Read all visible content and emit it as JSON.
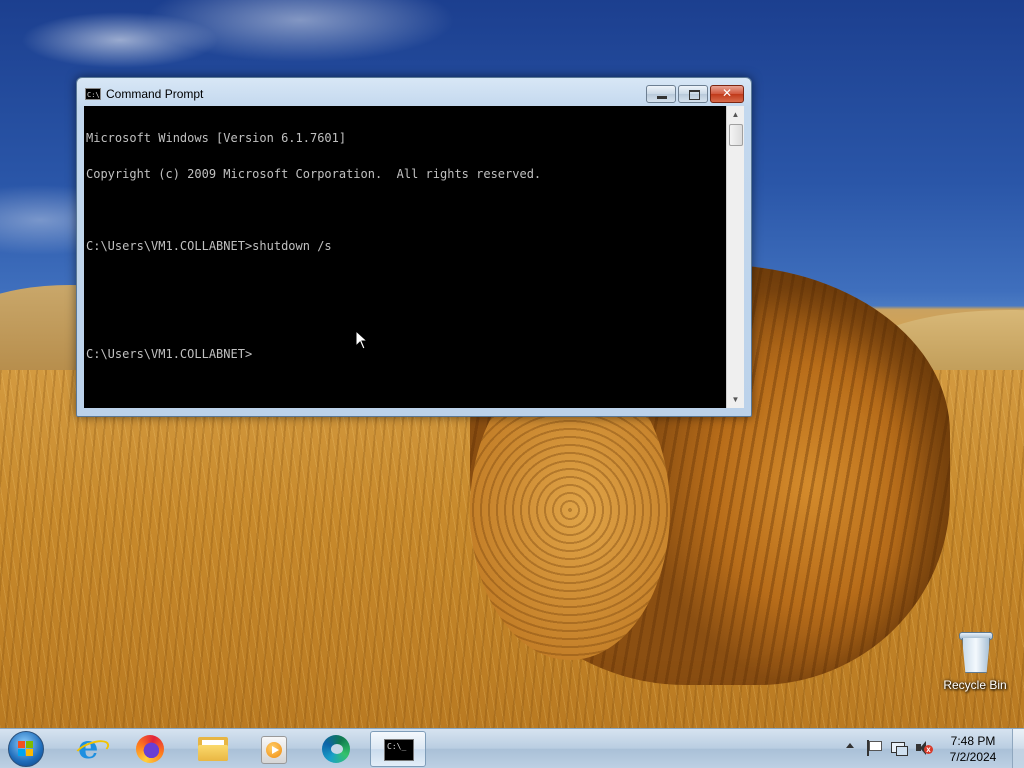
{
  "desktop": {
    "icons": [
      {
        "label": "Recycle Bin",
        "icon": "recycle-bin-icon"
      }
    ]
  },
  "cmd_window": {
    "title": "Command Prompt",
    "icon": "cmd-icon",
    "buttons": {
      "minimize": "minimize-icon",
      "maximize": "maximize-icon",
      "close": "✕"
    },
    "console_lines": [
      "Microsoft Windows [Version 6.1.7601]",
      "Copyright (c) 2009 Microsoft Corporation.  All rights reserved.",
      "",
      "C:\\Users\\VM1.COLLABNET>shutdown /s",
      "",
      "",
      "C:\\Users\\VM1.COLLABNET>"
    ],
    "colors": {
      "background": "#000000",
      "text": "#c0c0c0"
    }
  },
  "taskbar": {
    "start_icon": "windows-start-icon",
    "pinned": [
      {
        "name": "internet-explorer-icon"
      },
      {
        "name": "firefox-icon"
      },
      {
        "name": "file-explorer-icon"
      },
      {
        "name": "media-player-icon"
      },
      {
        "name": "edge-icon"
      },
      {
        "name": "command-prompt-icon",
        "active": true
      }
    ],
    "tray": {
      "icons": [
        "show-hidden-icons-arrow",
        "action-center-flag-icon",
        "network-icon",
        "volume-muted-icon"
      ],
      "time": "7:48 PM",
      "date": "7/2/2024"
    }
  }
}
